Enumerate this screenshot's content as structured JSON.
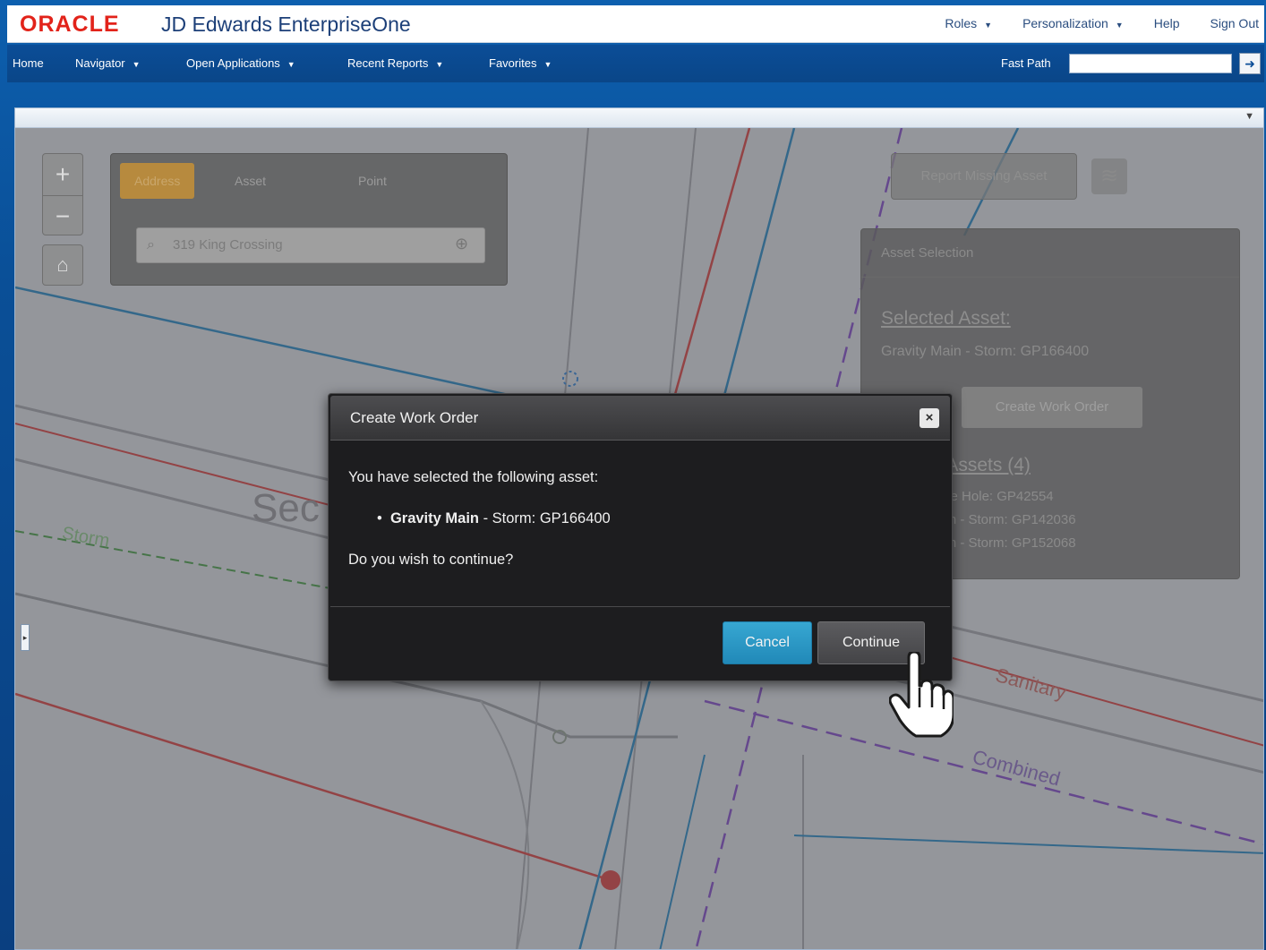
{
  "header": {
    "logo": "ORACLE",
    "product": "JD Edwards EnterpriseOne",
    "links": [
      {
        "label": "Roles",
        "caret": "▼"
      },
      {
        "label": "Personalization",
        "caret": "▼"
      },
      {
        "label": "Help",
        "caret": ""
      },
      {
        "label": "Sign Out",
        "caret": ""
      }
    ]
  },
  "nav": {
    "items": [
      {
        "label": "Home",
        "caret": ""
      },
      {
        "label": "Navigator",
        "caret": "▼"
      },
      {
        "label": "Open Applications",
        "caret": "▼"
      },
      {
        "label": "Recent Reports",
        "caret": "▼"
      },
      {
        "label": "Favorites",
        "caret": "▼"
      }
    ],
    "fastpath_label": "Fast Path",
    "fastpath_value": "",
    "go_icon": "➜"
  },
  "frame": {
    "menu_icon": "▼",
    "side_tab_icon": "▸"
  },
  "map": {
    "zoom_in": "+",
    "zoom_out": "−",
    "home_icon": "⌂",
    "search_tabs": [
      "Address",
      "Asset",
      "Point"
    ],
    "search_value": "319 King Crossing",
    "search_icon": "⌕",
    "target_icon": "⊕",
    "report_button": "Report Missing Asset",
    "layers_icon": "≋",
    "asset_panel": {
      "title": "Asset Selection",
      "selected_heading": "Selected Asset:",
      "selected_value": "Gravity Main - Storm: GP166400",
      "create_button": "Create Work Order",
      "nearby_heading": "Nearby Assets (4)",
      "nearby_items": [
        "Maintenance Hole: GP42554",
        "Gravity Main - Storm: GP142036",
        "Gravity Main - Storm: GP152068"
      ]
    },
    "labels": {
      "street1": "Sec",
      "storm": "Storm",
      "sanitary": "Sanitary",
      "combined": "Combined"
    }
  },
  "modal": {
    "title": "Create Work Order",
    "close_icon": "×",
    "intro": "You have selected the following asset:",
    "asset_name": "Gravity Main",
    "asset_detail": " - Storm: GP166400",
    "bullet": "•",
    "question": "Do you wish to continue?",
    "cancel": "Cancel",
    "continue": "Continue"
  },
  "colors": {
    "oracle_red": "#e2231a",
    "nav_blue": "#0b4d97",
    "cancel_blue": "#2aa1cf"
  }
}
